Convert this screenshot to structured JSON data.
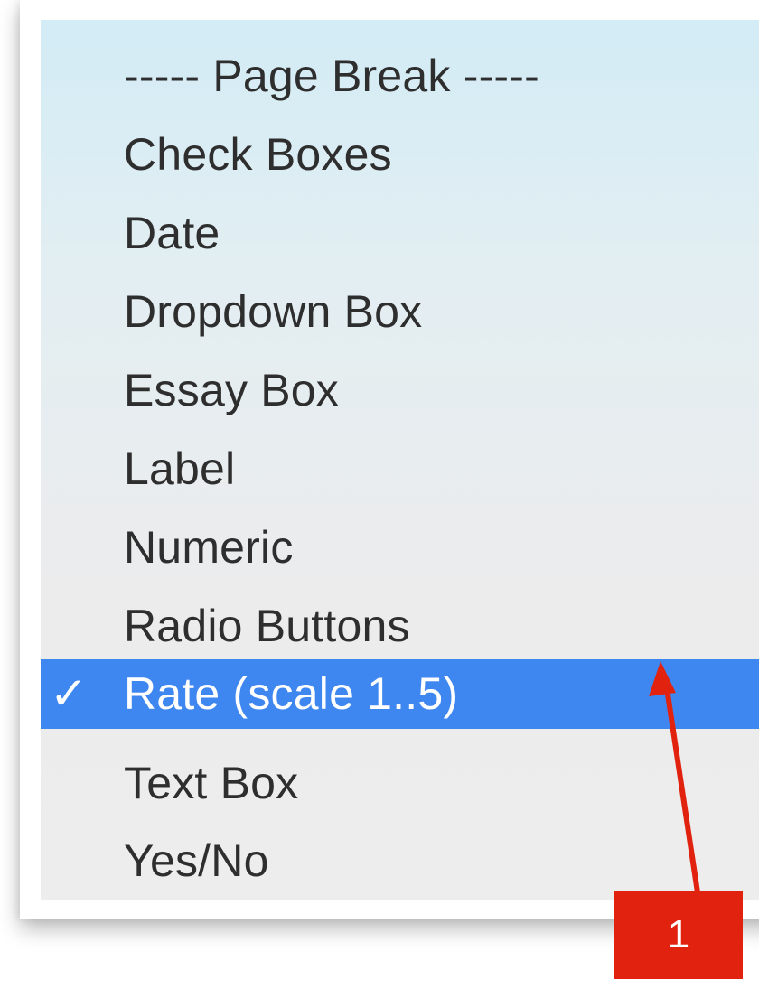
{
  "menu": {
    "items": [
      {
        "label": "----- Page Break -----",
        "selected": false
      },
      {
        "label": "Check Boxes",
        "selected": false
      },
      {
        "label": "Date",
        "selected": false
      },
      {
        "label": "Dropdown Box",
        "selected": false
      },
      {
        "label": "Essay Box",
        "selected": false
      },
      {
        "label": "Label",
        "selected": false
      },
      {
        "label": "Numeric",
        "selected": false
      },
      {
        "label": "Radio Buttons",
        "selected": false
      },
      {
        "label": "Rate (scale 1..5)",
        "selected": true
      },
      {
        "label": "Text Box",
        "selected": false
      },
      {
        "label": "Yes/No",
        "selected": false
      }
    ],
    "check_glyph": "✓",
    "selected_color": "#3f87f0"
  },
  "annotation": {
    "number": "1",
    "color": "#e1220f",
    "icon": "red-arrow-up"
  }
}
